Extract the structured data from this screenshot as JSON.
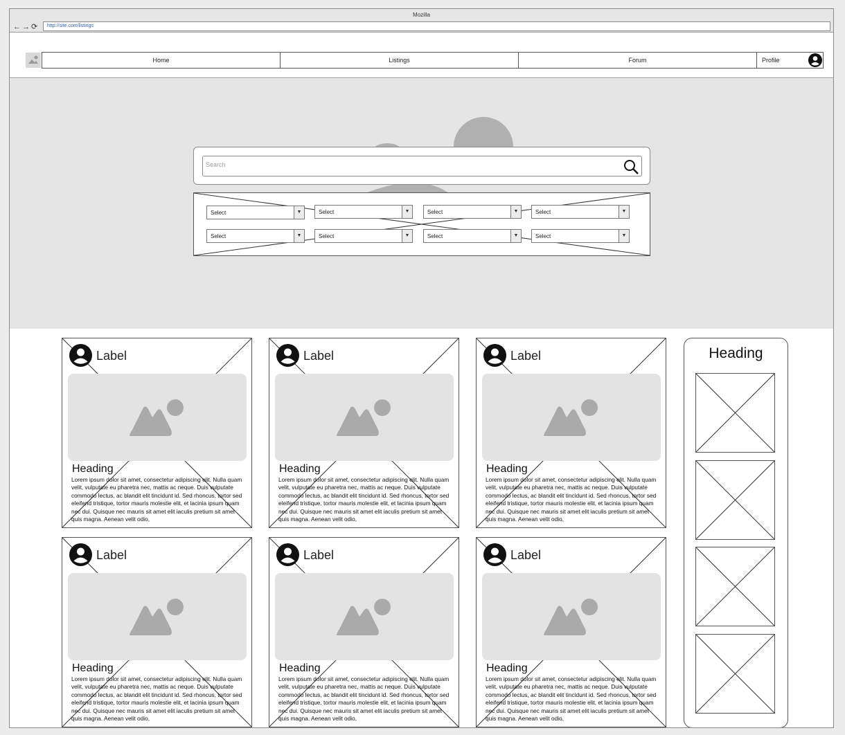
{
  "window": {
    "title": "Mozilla",
    "url": "http://site.com/listings",
    "nav_buttons": "←→⟳"
  },
  "nav": {
    "items": [
      "Home",
      "Listings",
      "Forum"
    ],
    "profile_label": "Profile"
  },
  "search": {
    "placeholder": "Search",
    "value": ""
  },
  "filters": {
    "selects": [
      "Select",
      "Select",
      "Select",
      "Select",
      "Select",
      "Select",
      "Select",
      "Select"
    ]
  },
  "cards": [
    {
      "label": "Label",
      "heading": "Heading",
      "body": "Lorem ipsum dolor sit amet, consectetur adipiscing elit. Nulla quam velit, vulputate eu pharetra nec, mattis ac neque. Duis vulputate commodo lectus, ac blandit elit tincidunt id. Sed rhoncus, tortor sed eleifend tristique, tortor mauris molestie elit, et lacinia ipsum quam nec dui. Quisque nec mauris sit amet elit iaculis pretium sit amet quis magna. Aenean velit odio,"
    },
    {
      "label": "Label",
      "heading": "Heading",
      "body": "Lorem ipsum dolor sit amet, consectetur adipiscing elit. Nulla quam velit, vulputate eu pharetra nec, mattis ac neque. Duis vulputate commodo lectus, ac blandit elit tincidunt id. Sed rhoncus, tortor sed eleifend tristique, tortor mauris molestie elit, et lacinia ipsum quam nec dui. Quisque nec mauris sit amet elit iaculis pretium sit amet quis magna. Aenean velit odio,"
    },
    {
      "label": "Label",
      "heading": "Heading",
      "body": "Lorem ipsum dolor sit amet, consectetur adipiscing elit. Nulla quam velit, vulputate eu pharetra nec, mattis ac neque. Duis vulputate commodo lectus, ac blandit elit tincidunt id. Sed rhoncus, tortor sed eleifend tristique, tortor mauris molestie elit, et lacinia ipsum quam nec dui. Quisque nec mauris sit amet elit iaculis pretium sit amet quis magna. Aenean velit odio,"
    },
    {
      "label": "Label",
      "heading": "Heading",
      "body": "Lorem ipsum dolor sit amet, consectetur adipiscing elit. Nulla quam velit, vulputate eu pharetra nec, mattis ac neque. Duis vulputate commodo lectus, ac blandit elit tincidunt id. Sed rhoncus, tortor sed eleifend tristique, tortor mauris molestie elit, et lacinia ipsum quam nec dui. Quisque nec mauris sit amet elit iaculis pretium sit amet quis magna. Aenean velit odio,"
    },
    {
      "label": "Label",
      "heading": "Heading",
      "body": "Lorem ipsum dolor sit amet, consectetur adipiscing elit. Nulla quam velit, vulputate eu pharetra nec, mattis ac neque. Duis vulputate commodo lectus, ac blandit elit tincidunt id. Sed rhoncus, tortor sed eleifend tristique, tortor mauris molestie elit, et lacinia ipsum quam nec dui. Quisque nec mauris sit amet elit iaculis pretium sit amet quis magna. Aenean velit odio,"
    },
    {
      "label": "Label",
      "heading": "Heading",
      "body": "Lorem ipsum dolor sit amet, consectetur adipiscing elit. Nulla quam velit, vulputate eu pharetra nec, mattis ac neque. Duis vulputate commodo lectus, ac blandit elit tincidunt id. Sed rhoncus, tortor sed eleifend tristique, tortor mauris molestie elit, et lacinia ipsum quam nec dui. Quisque nec mauris sit amet elit iaculis pretium sit amet quis magna. Aenean velit odio,"
    }
  ],
  "sidebar": {
    "heading": "Heading"
  }
}
